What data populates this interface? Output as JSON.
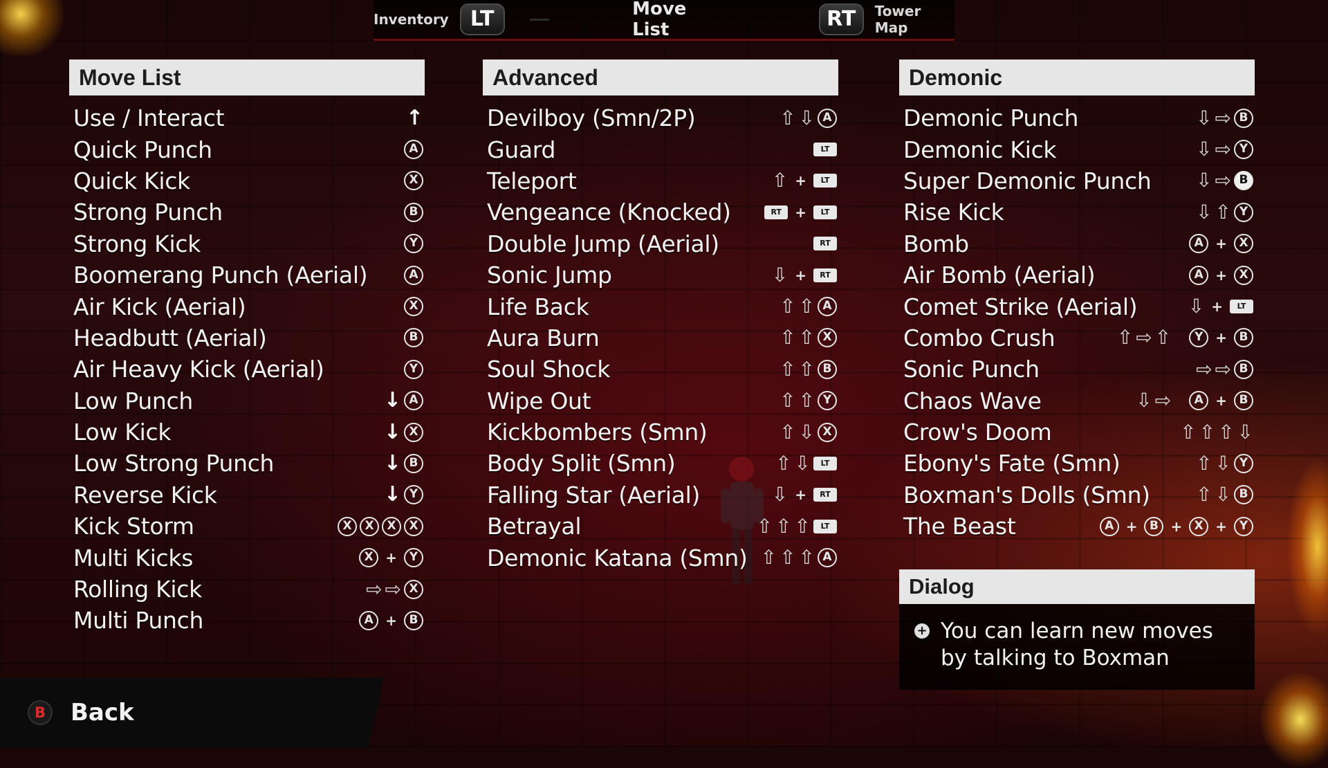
{
  "topnav": {
    "left_label": "Inventory",
    "left_trigger": "LT",
    "title": "Move List",
    "right_trigger": "RT",
    "right_label": "Tower Map"
  },
  "panels": [
    {
      "header": "Move List",
      "rows": [
        {
          "name": "Use / Interact",
          "inputs": [
            "up-solid-arrow"
          ]
        },
        {
          "name": "Quick Punch",
          "inputs": [
            "A"
          ]
        },
        {
          "name": "Quick Kick",
          "inputs": [
            "X"
          ]
        },
        {
          "name": "Strong Punch",
          "inputs": [
            "B"
          ]
        },
        {
          "name": "Strong Kick",
          "inputs": [
            "Y"
          ]
        },
        {
          "name": "Boomerang Punch (Aerial)",
          "inputs": [
            "A"
          ]
        },
        {
          "name": "Air Kick (Aerial)",
          "inputs": [
            "X"
          ]
        },
        {
          "name": "Headbutt (Aerial)",
          "inputs": [
            "B"
          ]
        },
        {
          "name": "Air Heavy Kick (Aerial)",
          "inputs": [
            "Y"
          ]
        },
        {
          "name": "Low Punch",
          "inputs": [
            "down-solid-arrow",
            "A"
          ]
        },
        {
          "name": "Low Kick",
          "inputs": [
            "down-solid-arrow",
            "X"
          ]
        },
        {
          "name": "Low Strong Punch",
          "inputs": [
            "down-solid-arrow",
            "B"
          ]
        },
        {
          "name": "Reverse Kick",
          "inputs": [
            "down-solid-arrow",
            "Y"
          ]
        },
        {
          "name": "Kick Storm",
          "inputs": [
            "X",
            "X",
            "X",
            "X"
          ]
        },
        {
          "name": "Multi Kicks",
          "inputs": [
            "X",
            "+",
            "Y"
          ]
        },
        {
          "name": "Rolling Kick",
          "inputs": [
            "right-arrow",
            "right-arrow",
            "X"
          ]
        },
        {
          "name": "Multi Punch",
          "inputs": [
            "A",
            "+",
            "B"
          ]
        }
      ]
    },
    {
      "header": "Advanced",
      "rows": [
        {
          "name": "Devilboy (Smn/2P)",
          "inputs": [
            "up-arrow",
            "down-arrow",
            "A"
          ]
        },
        {
          "name": "Guard",
          "inputs": [
            "LT"
          ]
        },
        {
          "name": "Teleport",
          "inputs": [
            "up-arrow",
            "+",
            "LT"
          ]
        },
        {
          "name": "Vengeance (Knocked)",
          "inputs": [
            "RT",
            "+",
            "LT"
          ]
        },
        {
          "name": "Double Jump (Aerial)",
          "inputs": [
            "RT"
          ]
        },
        {
          "name": "Sonic Jump",
          "inputs": [
            "down-arrow",
            "+",
            "RT"
          ]
        },
        {
          "name": "Life Back",
          "inputs": [
            "up-arrow",
            "up-arrow",
            "A"
          ]
        },
        {
          "name": "Aura Burn",
          "inputs": [
            "up-arrow",
            "up-arrow",
            "X"
          ]
        },
        {
          "name": "Soul Shock",
          "inputs": [
            "up-arrow",
            "up-arrow",
            "B"
          ]
        },
        {
          "name": "Wipe Out",
          "inputs": [
            "up-arrow",
            "up-arrow",
            "Y"
          ]
        },
        {
          "name": "Kickbombers (Smn)",
          "inputs": [
            "up-arrow",
            "down-arrow",
            "X"
          ]
        },
        {
          "name": "Body Split (Smn)",
          "inputs": [
            "up-arrow",
            "down-arrow",
            "LT"
          ]
        },
        {
          "name": "Falling Star (Aerial)",
          "inputs": [
            "down-arrow",
            "+",
            "RT"
          ]
        },
        {
          "name": "Betrayal",
          "inputs": [
            "up-arrow",
            "up-arrow",
            "up-arrow",
            "LT"
          ]
        },
        {
          "name": "Demonic Katana (Smn)",
          "inputs": [
            "up-arrow",
            "up-arrow",
            "up-arrow",
            "A"
          ]
        }
      ]
    },
    {
      "header": "Demonic",
      "rows": [
        {
          "name": "Demonic Punch",
          "inputs": [
            "down-arrow",
            "right-arrow",
            "B"
          ]
        },
        {
          "name": "Demonic Kick",
          "inputs": [
            "down-arrow",
            "right-arrow",
            "Y"
          ]
        },
        {
          "name": "Super Demonic Punch",
          "inputs": [
            "down-arrow",
            "right-arrow",
            "B-filled"
          ]
        },
        {
          "name": "Rise Kick",
          "inputs": [
            "down-arrow",
            "up-arrow",
            "Y"
          ]
        },
        {
          "name": "Bomb",
          "inputs": [
            "A",
            "+",
            "X"
          ]
        },
        {
          "name": "Air Bomb (Aerial)",
          "inputs": [
            "A",
            "+",
            "X"
          ]
        },
        {
          "name": "Comet Strike (Aerial)",
          "inputs": [
            "down-arrow",
            "+",
            "LT"
          ]
        },
        {
          "name": "Combo Crush",
          "inputs": [
            "up-arrow",
            "right-arrow",
            "up-arrow",
            "gap",
            "Y",
            "+",
            "B"
          ]
        },
        {
          "name": "Sonic Punch",
          "inputs": [
            "right-arrow",
            "right-arrow",
            "B"
          ]
        },
        {
          "name": "Chaos Wave",
          "inputs": [
            "down-arrow",
            "right-arrow",
            "gap",
            "A",
            "+",
            "B"
          ]
        },
        {
          "name": "Crow's Doom",
          "inputs": [
            "up-arrow",
            "up-arrow",
            "up-arrow",
            "down-arrow"
          ]
        },
        {
          "name": "Ebony's Fate (Smn)",
          "inputs": [
            "up-arrow",
            "down-arrow",
            "Y"
          ]
        },
        {
          "name": "Boxman's Dolls (Smn)",
          "inputs": [
            "up-arrow",
            "down-arrow",
            "B"
          ]
        },
        {
          "name": "The Beast",
          "inputs": [
            "A",
            "+",
            "B",
            "+",
            "X",
            "+",
            "Y"
          ]
        }
      ]
    }
  ],
  "dialog": {
    "header": "Dialog",
    "text": "You can learn new moves by talking to Boxman"
  },
  "back": {
    "button": "B",
    "label": "Back"
  },
  "colors": {
    "header_bg": "#e6e6e6",
    "nav_accent": "#6a0e12",
    "back_button": "#e02828"
  }
}
